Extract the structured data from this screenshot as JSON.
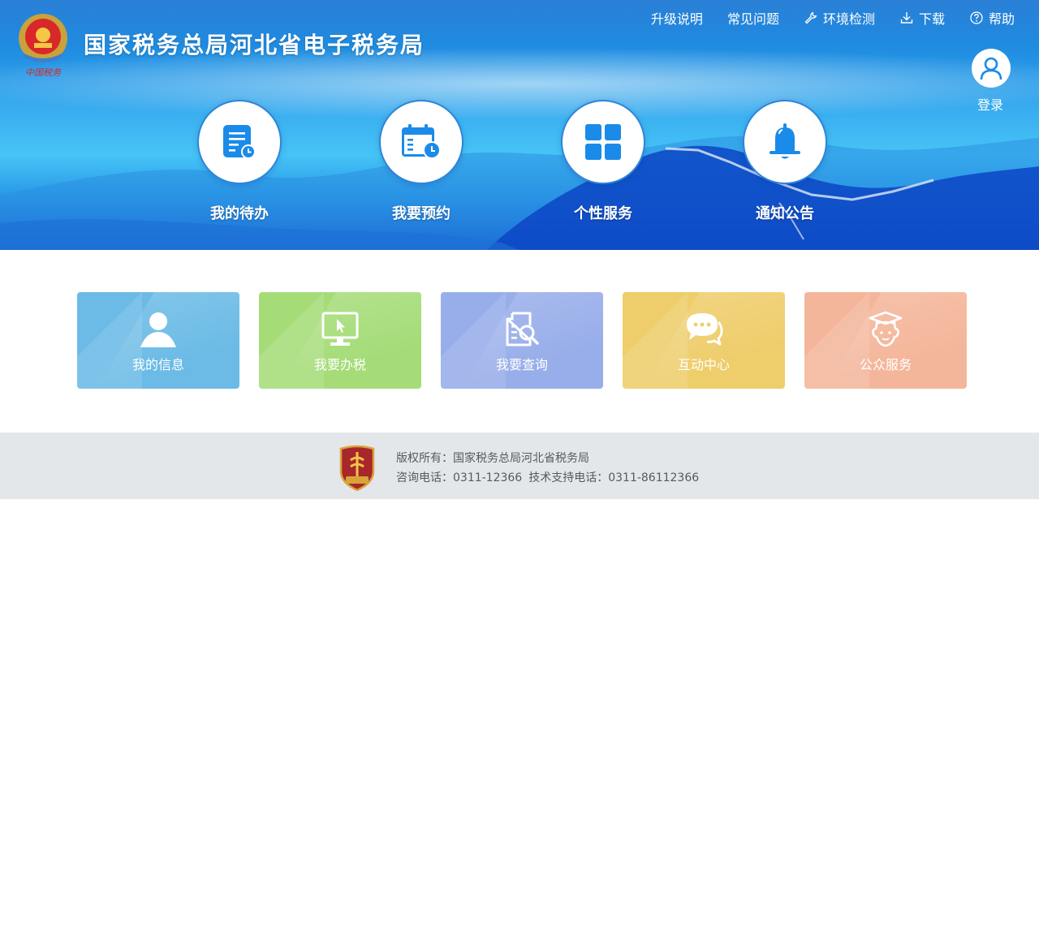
{
  "header": {
    "site_title": "国家税务总局河北省电子税务局",
    "logo_icon": "tax-emblem-icon",
    "nav": [
      {
        "label": "升级说明",
        "icon": ""
      },
      {
        "label": "常见问题",
        "icon": ""
      },
      {
        "label": "环境检测",
        "icon": "wrench-icon"
      },
      {
        "label": "下载",
        "icon": "download-icon"
      },
      {
        "label": "帮助",
        "icon": "help-icon"
      }
    ],
    "login_label": "登录"
  },
  "quick_entries": [
    {
      "label": "我的待办",
      "icon": "todo-list-icon"
    },
    {
      "label": "我要预约",
      "icon": "calendar-clock-icon"
    },
    {
      "label": "个性服务",
      "icon": "grid-icon"
    },
    {
      "label": "通知公告",
      "icon": "bell-icon"
    }
  ],
  "tiles": [
    {
      "label": "我的信息",
      "icon": "user-icon",
      "color": "#6bbbe6"
    },
    {
      "label": "我要办税",
      "icon": "monitor-cursor-icon",
      "color": "#a5dc78"
    },
    {
      "label": "我要查询",
      "icon": "document-search-icon",
      "color": "#98aeea"
    },
    {
      "label": "互动中心",
      "icon": "chat-bubbles-icon",
      "color": "#eecd6b"
    },
    {
      "label": "公众服务",
      "icon": "graduate-icon",
      "color": "#f4b69a"
    }
  ],
  "footer": {
    "copyright": "版权所有：国家税务总局河北省税务局",
    "consult_phone": "咨询电话：0311-12366",
    "support_phone": "技术支持电话：0311-86112366",
    "badge_icon": "party-government-badge-icon"
  },
  "colors": {
    "accent": "#2d86d8",
    "footer_bg": "#e4e7ea",
    "icon_blue": "#1a8be8"
  }
}
